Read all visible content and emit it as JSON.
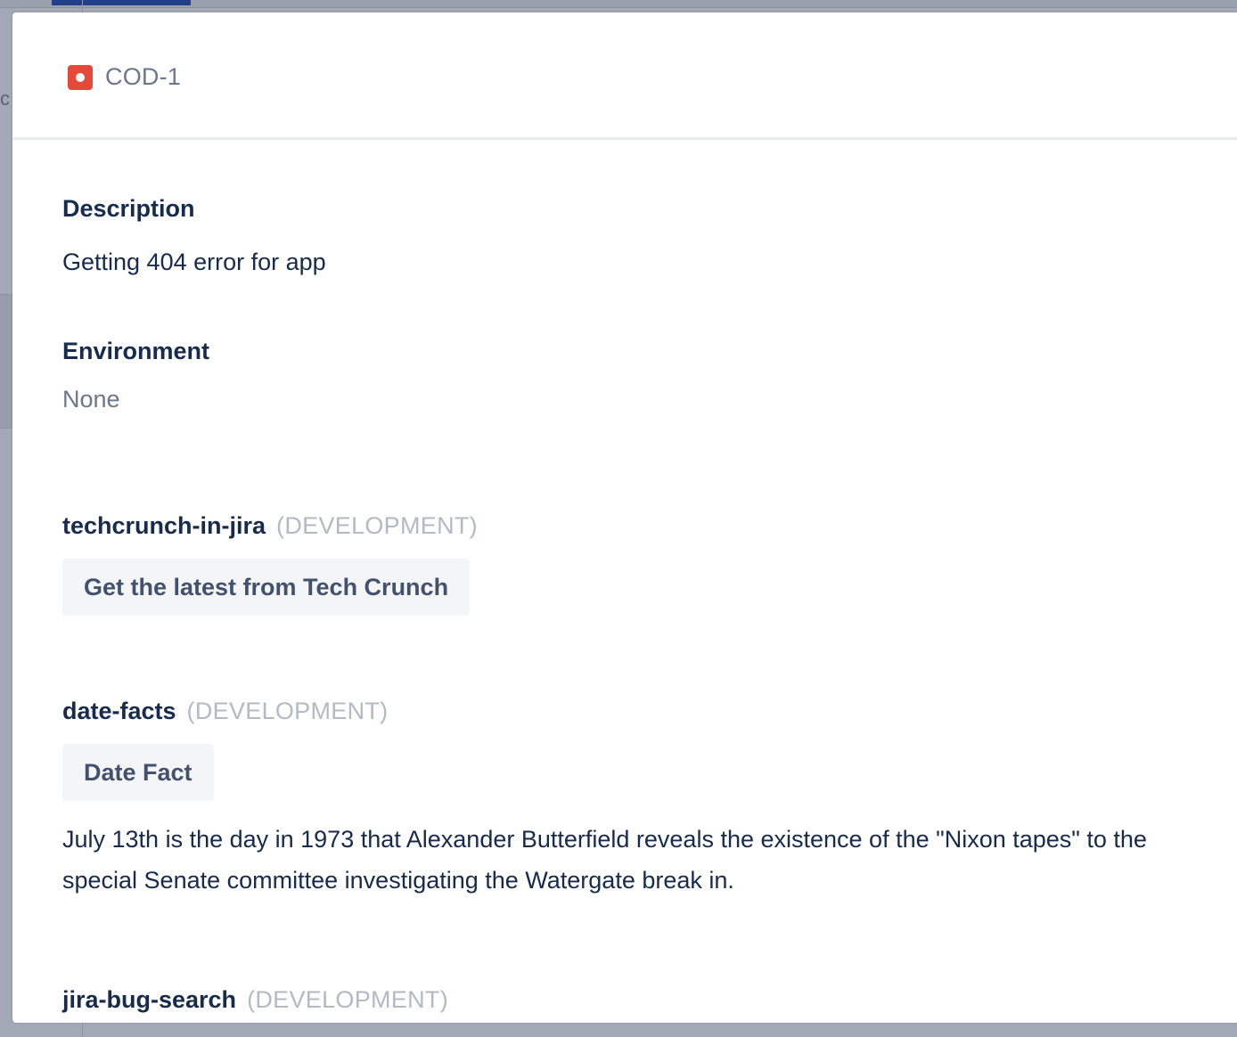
{
  "background": {
    "partial_letter": "c"
  },
  "issue": {
    "key": "COD-1",
    "type_icon": "bug-icon",
    "type_color": "#e5493a"
  },
  "description": {
    "heading": "Description",
    "text": "Getting 404 error for app"
  },
  "environment": {
    "heading": "Environment",
    "text": "None"
  },
  "apps": [
    {
      "name": "techcrunch-in-jira",
      "env": "(DEVELOPMENT)",
      "button_label": "Get the latest from Tech Crunch"
    },
    {
      "name": "date-facts",
      "env": "(DEVELOPMENT)",
      "button_label": "Date Fact",
      "output": "July 13th is the day in 1973 that Alexander Butterfield reveals the existence of the \"Nixon tapes\" to the special Senate committee investigating the Watergate break in."
    },
    {
      "name": "jira-bug-search",
      "env": "(DEVELOPMENT)"
    }
  ],
  "colors": {
    "heading": "#172b4d",
    "muted": "#6b778c",
    "env_label": "#b3bac5",
    "button_bg": "#f4f5f7",
    "button_text": "#42526e"
  }
}
